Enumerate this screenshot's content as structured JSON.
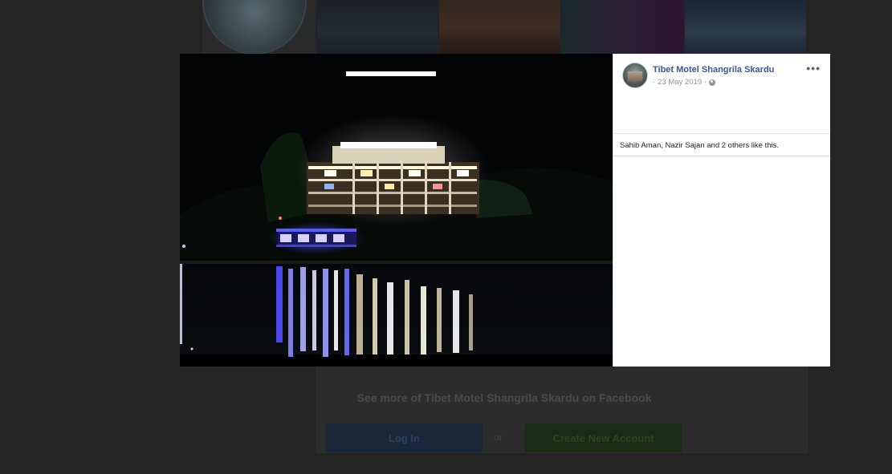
{
  "post": {
    "page_name": "Tibet Motel Shangrila Skardu",
    "date": "23 May 2019",
    "date_separator": "·",
    "privacy_icon": "globe-icon",
    "more_label": "•••",
    "likes_text": "Sahib Aman, Nazir Sajan and 2 others like this."
  },
  "footer": {
    "see_more": "See more of Tibet Motel Shangrila Skardu on Facebook",
    "login_label": "Log In",
    "or_label": "or",
    "create_label": "Create New Account"
  },
  "colors": {
    "link_blue": "#385898",
    "meta_gray": "#90949c",
    "backdrop": "#242424"
  }
}
